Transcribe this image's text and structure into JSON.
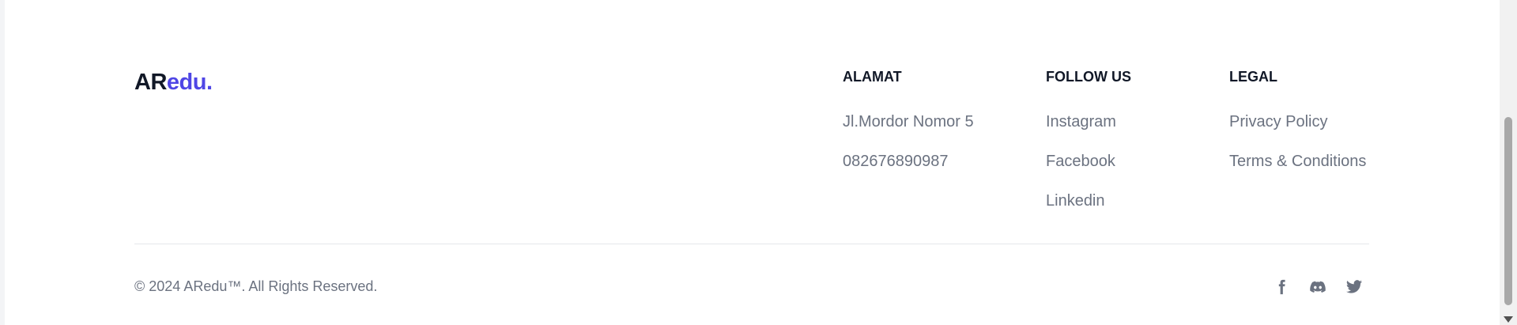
{
  "logo": {
    "part1": "AR",
    "part2": "edu."
  },
  "alamat": {
    "heading": "ALAMAT",
    "items": [
      "Jl.Mordor Nomor 5",
      "082676890987"
    ]
  },
  "follow": {
    "heading": "FOLLOW US",
    "items": [
      "Instagram",
      "Facebook",
      "Linkedin"
    ]
  },
  "legal": {
    "heading": "LEGAL",
    "items": [
      "Privacy Policy",
      "Terms & Conditions"
    ]
  },
  "footer": {
    "copyright": "© 2024 ARedu™. All Rights Reserved."
  },
  "social": [
    "facebook-icon",
    "discord-icon",
    "twitter-icon"
  ],
  "colors": {
    "accent": "#4f46e5",
    "text": "#111827",
    "muted": "#6b7280"
  }
}
